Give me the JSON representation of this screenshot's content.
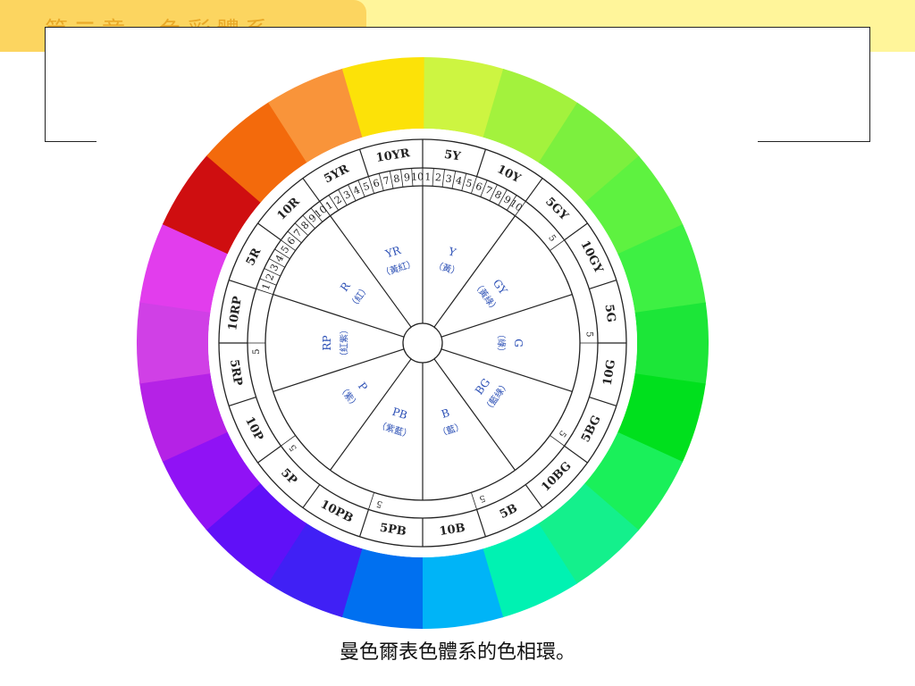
{
  "header": {
    "chapter_title": "第二章　色彩體系",
    "band_color": "#fff59a",
    "tab_color": "#fcd560"
  },
  "diagram": {
    "outer_ring_colors": [
      "#cdf541",
      "#a3f23d",
      "#7cf03e",
      "#5ef240",
      "#3ef043",
      "#1ce638",
      "#00e01d",
      "#1af05a",
      "#14f08c",
      "#00f2b2",
      "#00b4f7",
      "#0070f0",
      "#4020f5",
      "#6010f8",
      "#9012f5",
      "#b522e6",
      "#d040e6",
      "#e23ded",
      "#cf0e10",
      "#f36a0c",
      "#f9943a",
      "#fce208"
    ],
    "hue_labels": [
      "5Y",
      "10Y",
      "5GY",
      "10GY",
      "5G",
      "10G",
      "5BG",
      "10BG",
      "5B",
      "10B",
      "5PB",
      "10PB",
      "5P",
      "10P",
      "5RP",
      "10RP",
      "5R",
      "10R",
      "5YR",
      "10YR"
    ],
    "tick_numbers": [
      "1",
      "2",
      "3",
      "4",
      "5",
      "6",
      "7",
      "8",
      "9",
      "10"
    ],
    "minor_mark": "5",
    "sector_labels": [
      {
        "code": "Y",
        "name": "（黃）"
      },
      {
        "code": "GY",
        "name": "（黃綠）"
      },
      {
        "code": "G",
        "name": "（綠）"
      },
      {
        "code": "BG",
        "name": "（藍綠）"
      },
      {
        "code": "B",
        "name": "（藍）"
      },
      {
        "code": "PB",
        "name": "（紫藍）"
      },
      {
        "code": "P",
        "name": "（紫）"
      },
      {
        "code": "RP",
        "name": "（紅紫）"
      },
      {
        "code": "R",
        "name": "（紅）"
      },
      {
        "code": "YR",
        "name": "（黃紅）"
      }
    ],
    "label_color": "#2b4fb5"
  },
  "caption": "曼色爾表色體系的色相環。"
}
